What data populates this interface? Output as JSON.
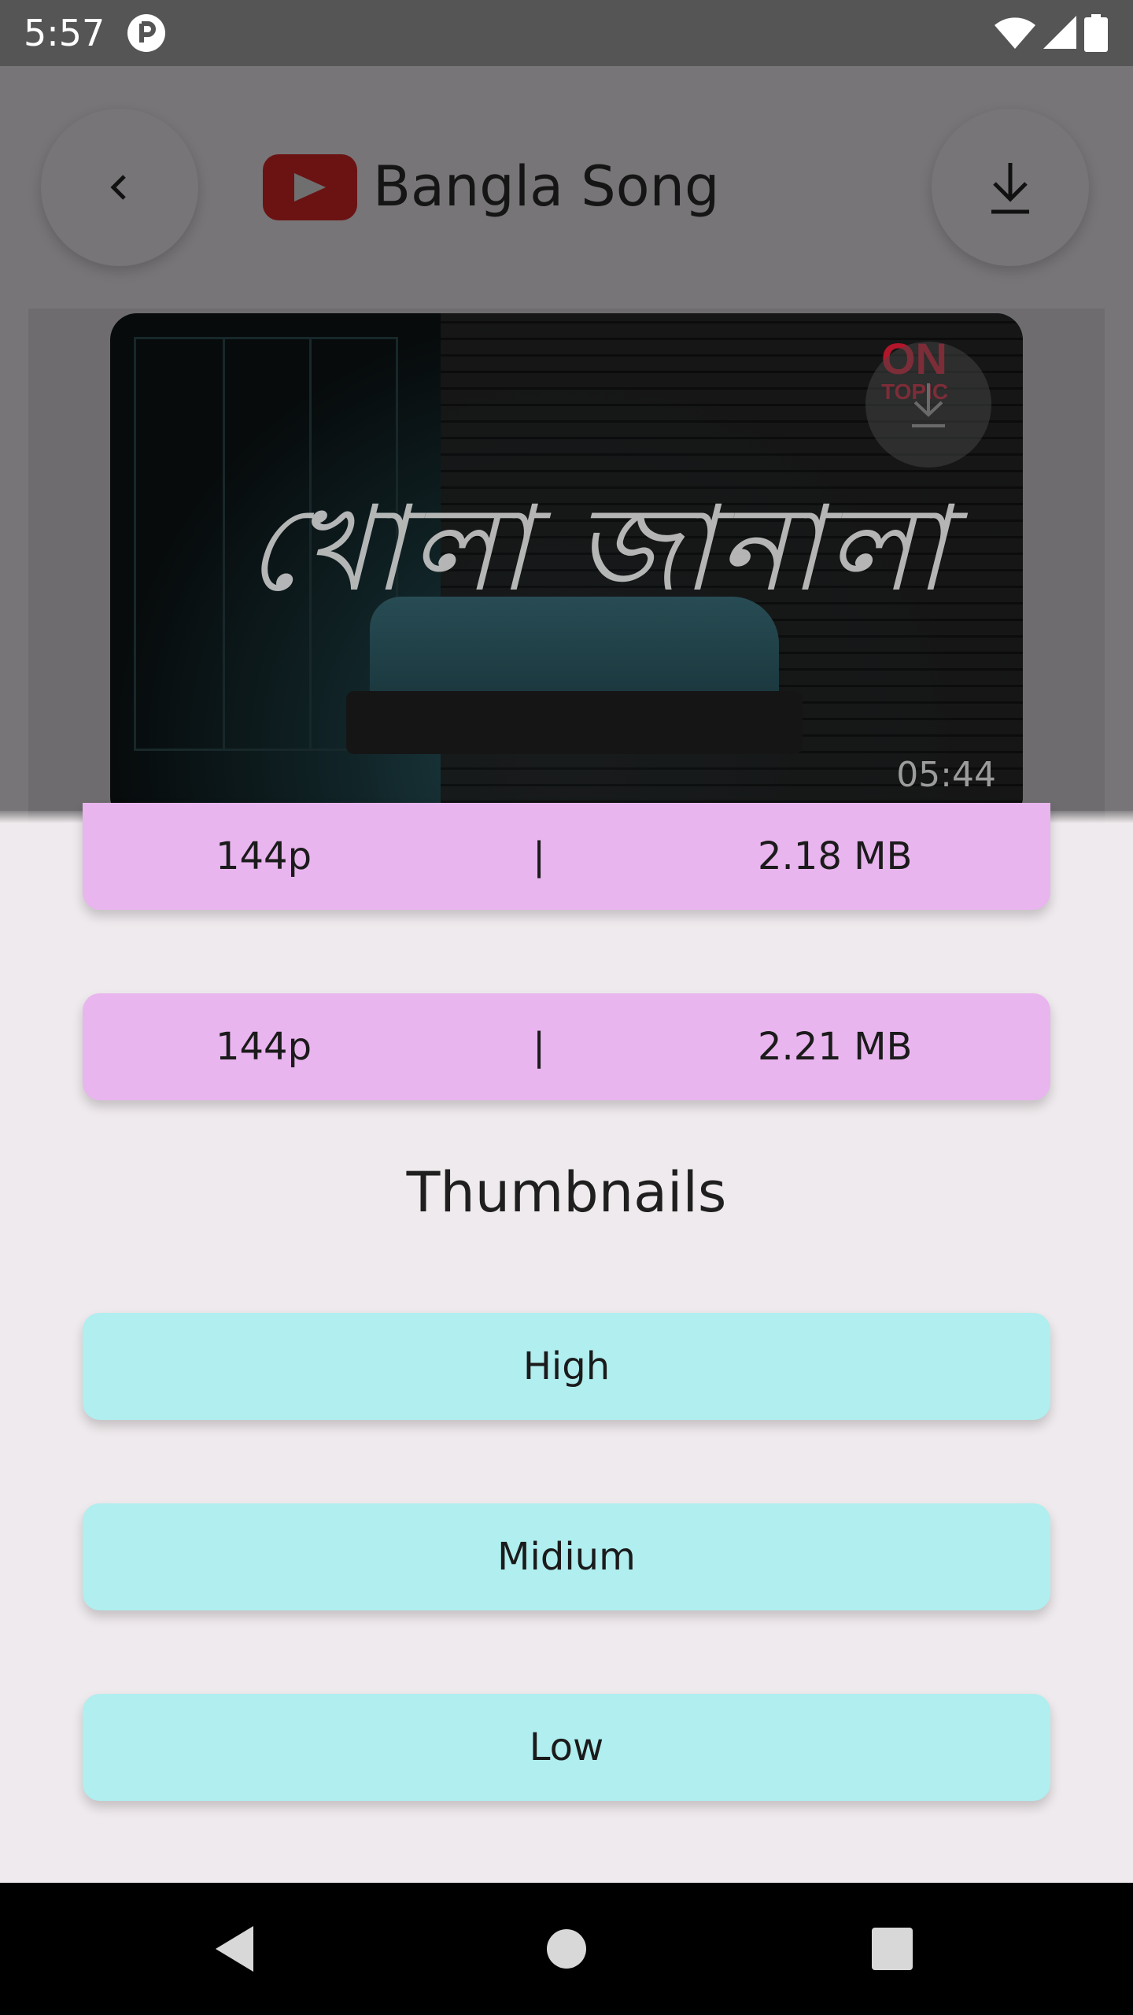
{
  "status_bar": {
    "time": "5:57"
  },
  "header": {
    "title": "Bangla Song"
  },
  "video": {
    "overlay_text": "খোলা জানালা",
    "logo_top": "ON",
    "logo_bottom": "TOPIC",
    "duration": "05:44"
  },
  "qualities": [
    {
      "resolution": "144p",
      "separator": "|",
      "size": "2.18 MB"
    },
    {
      "resolution": "144p",
      "separator": "|",
      "size": "2.21 MB"
    }
  ],
  "thumbnails": {
    "title": "Thumbnails",
    "options": [
      "High",
      "Midium",
      "Low"
    ]
  },
  "colors": {
    "quality_button": "#e9b5ee",
    "thumbnail_button": "#b0eeef",
    "youtube_logo": "#6b1313"
  }
}
